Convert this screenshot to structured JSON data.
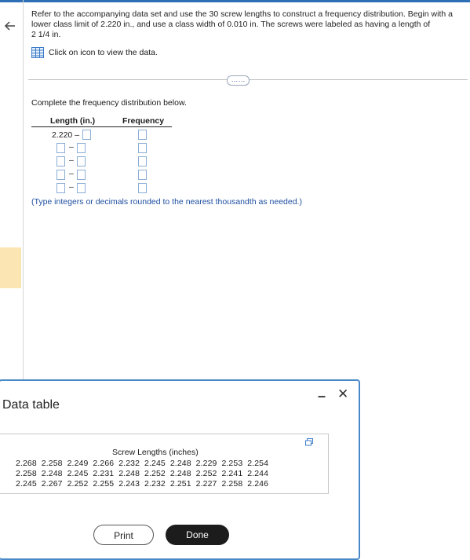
{
  "instructions": {
    "line1": "Refer to the accompanying data set and use the 30 screw lengths to construct a frequency distribution. Begin with a",
    "line2": "lower class limit of 2.220 in., and use a class width of 0.010 in. The screws were labeled as having a length of",
    "line3": "2 1/4 in."
  },
  "data_link": {
    "label": "Click on icon to view the data.",
    "icon": "table-grid-icon"
  },
  "more_button": {
    "label": "……"
  },
  "question": {
    "prompt": "Complete the frequency distribution below.",
    "col_length": "Length (in.)",
    "col_frequency": "Frequency",
    "start_value": "2.220 –",
    "dash": "–",
    "note": "(Type integers or decimals rounded to the nearest thousandth as needed.)"
  },
  "modal": {
    "title": "Data table",
    "minimize_label": "–",
    "close_label": "✕",
    "table_title": "Screw Lengths (inches)",
    "rows": [
      "2.268  2.258  2.249  2.266  2.232  2.245  2.248  2.229  2.253  2.254",
      "2.258  2.248  2.245  2.231  2.248  2.252  2.248  2.252  2.241  2.244",
      "2.245  2.267  2.252  2.255  2.243  2.232  2.251  2.227  2.258  2.246"
    ],
    "print_label": "Print",
    "done_label": "Done"
  },
  "colors": {
    "accent": "#2c6fb7",
    "note_text": "#1f4fa0",
    "input_border": "#8aaed6",
    "highlight": "#fbe6b3",
    "done_bg": "#1c1c1c"
  }
}
